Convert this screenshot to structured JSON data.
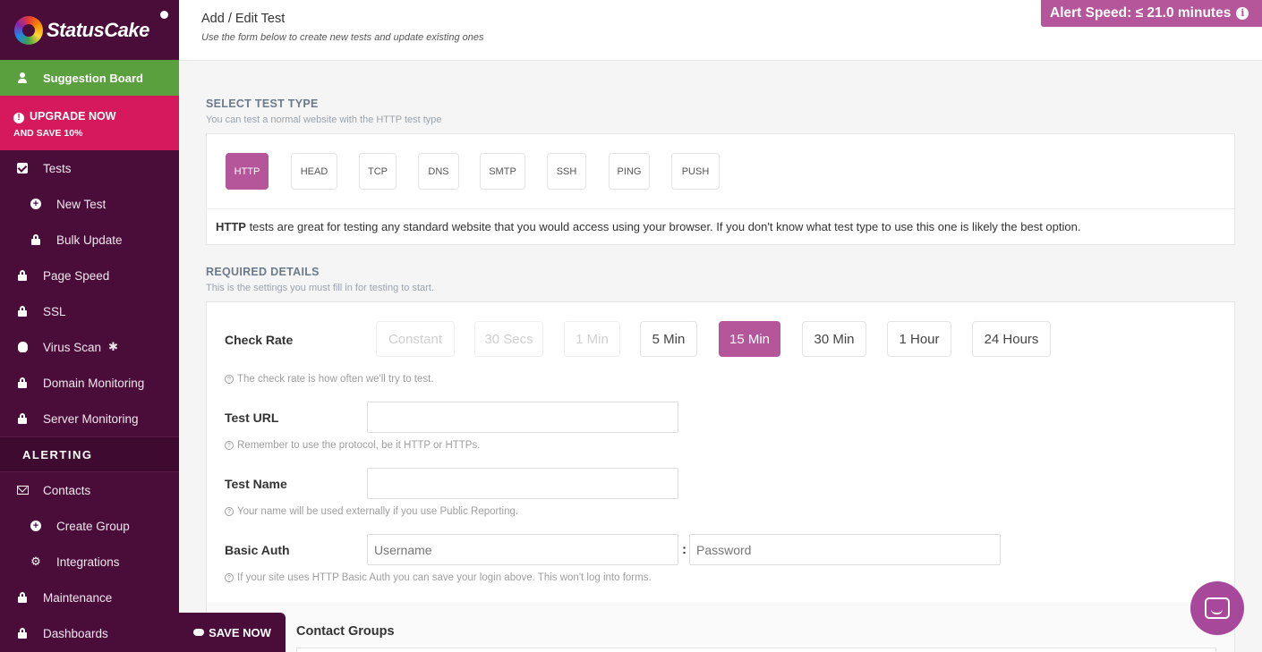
{
  "brand": {
    "name": "StatusCake"
  },
  "sidebar": {
    "suggestion": "Suggestion Board",
    "upgrade": {
      "line1": "UPGRADE NOW",
      "line2": "AND SAVE 10%"
    },
    "items": [
      {
        "label": "Tests",
        "icon": "check-square-icon"
      },
      {
        "label": "New Test",
        "icon": "plus-circle-icon"
      },
      {
        "label": "Bulk Update",
        "icon": "lock-icon"
      },
      {
        "label": "Page Speed",
        "icon": "lock-icon"
      },
      {
        "label": "SSL",
        "icon": "lock-icon"
      },
      {
        "label": "Virus Scan",
        "icon": "bug-icon",
        "badge": "✱"
      },
      {
        "label": "Domain Monitoring",
        "icon": "lock-icon"
      },
      {
        "label": "Server Monitoring",
        "icon": "lock-icon"
      }
    ],
    "alerting_header": "ALERTING",
    "alerting_items": [
      {
        "label": "Contacts",
        "icon": "envelope-icon"
      },
      {
        "label": "Create Group",
        "icon": "plus-circle-icon"
      },
      {
        "label": "Integrations",
        "icon": "cogs-icon"
      },
      {
        "label": "Maintenance",
        "icon": "lock-icon"
      },
      {
        "label": "Dashboards",
        "icon": "lock-icon"
      }
    ],
    "save_now": "SAVE NOW"
  },
  "header": {
    "title": "Add / Edit Test",
    "subtitle": "Use the form below to create new tests and update existing ones",
    "alert_speed": "Alert Speed: ≤ 21.0 minutes"
  },
  "test_type": {
    "heading": "SELECT TEST TYPE",
    "subheading": "You can test a normal website with the HTTP test type",
    "types": [
      "HTTP",
      "HEAD",
      "TCP",
      "DNS",
      "SMTP",
      "SSH",
      "PING",
      "PUSH"
    ],
    "selected": "HTTP",
    "desc_bold": "HTTP",
    "desc_rest": " tests are great for testing any standard website that you would access using your browser. If you don't know what test type to use this one is likely the best option."
  },
  "required": {
    "heading": "REQUIRED DETAILS",
    "subheading": "This is the settings you must fill in for testing to start.",
    "check_rate": {
      "label": "Check Rate",
      "options": [
        "Constant",
        "30 Secs",
        "1 Min",
        "5 Min",
        "15 Min",
        "30 Min",
        "1 Hour",
        "24 Hours"
      ],
      "selected": "15 Min",
      "disabled": [
        "Constant",
        "30 Secs",
        "1 Min"
      ],
      "hint": "The check rate is how often we'll try to test."
    },
    "test_url": {
      "label": "Test URL",
      "value": "",
      "hint": "Remember to use the protocol, be it HTTP or HTTPs."
    },
    "test_name": {
      "label": "Test Name",
      "value": "",
      "hint": "Your name will be used externally if you use Public Reporting."
    },
    "basic_auth": {
      "label": "Basic Auth",
      "username_placeholder": "Username",
      "separator": ":",
      "password_placeholder": "Password",
      "hint": "If your site uses HTTP Basic Auth you can save your login above. This won't log into forms."
    },
    "contact_groups_label": "Contact Groups"
  }
}
